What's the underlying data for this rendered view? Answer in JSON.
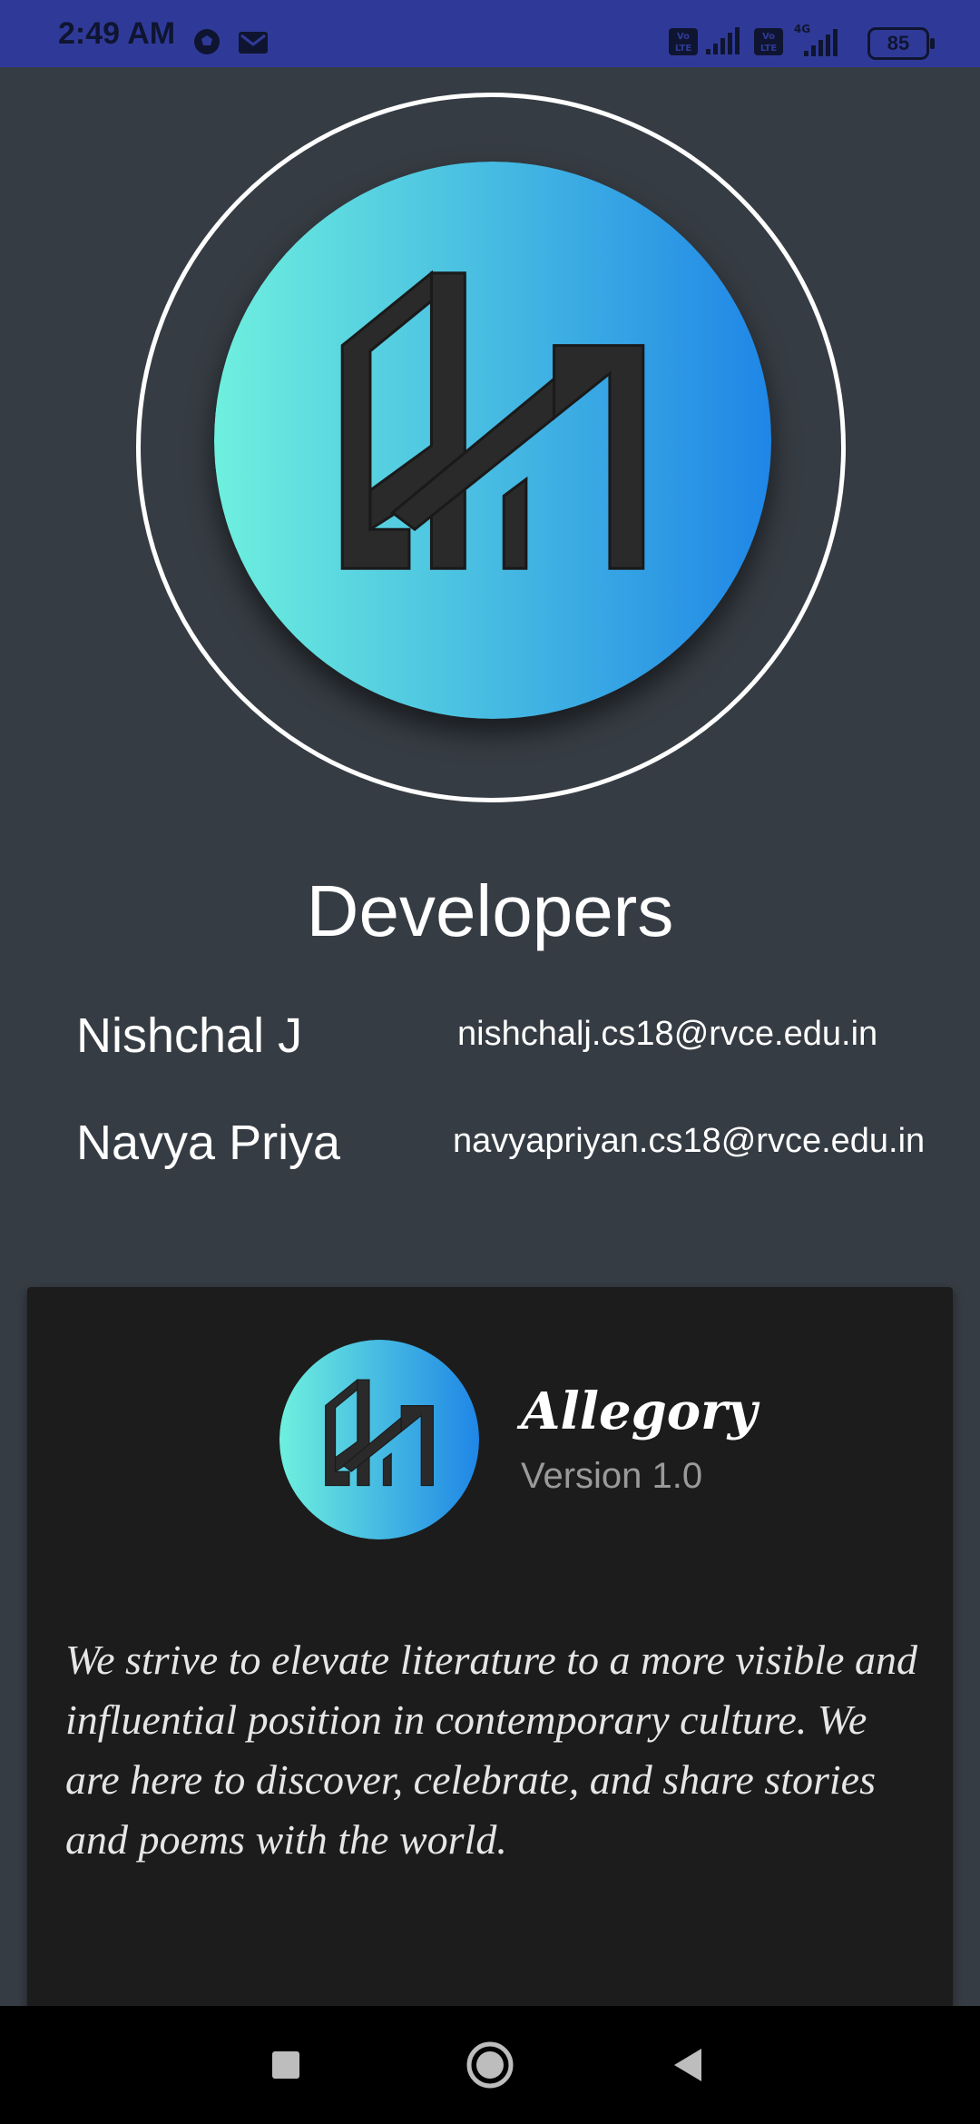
{
  "status_bar": {
    "time": "2:49 AM",
    "battery": "85",
    "icons": [
      "soccer-ball-icon",
      "gmail-icon",
      "volte-icon",
      "signal-icon",
      "4g-icon",
      "battery-icon"
    ]
  },
  "developers": {
    "title": "Developers",
    "people": [
      {
        "name": "Nishchal J",
        "email": "nishchalj.cs18@rvce.edu.in"
      },
      {
        "name": "Navya Priya",
        "email": "navyapriyan.cs18@rvce.edu.in"
      }
    ]
  },
  "about": {
    "app_name": "Allegory",
    "version": "Version 1.0",
    "description": "We strive to elevate literature to a more visible and influential position in contemporary culture. We are here to discover, celebrate, and share stories and poems with the world."
  },
  "colors": {
    "status_bar": "#2f3a98",
    "background": "#363c43",
    "card": "#1c1c1c",
    "logo_gradient_start": "#6ef0de",
    "logo_gradient_end": "#1f86e6"
  },
  "nav": {
    "icons": [
      "recent-apps-icon",
      "home-icon",
      "back-icon"
    ]
  }
}
